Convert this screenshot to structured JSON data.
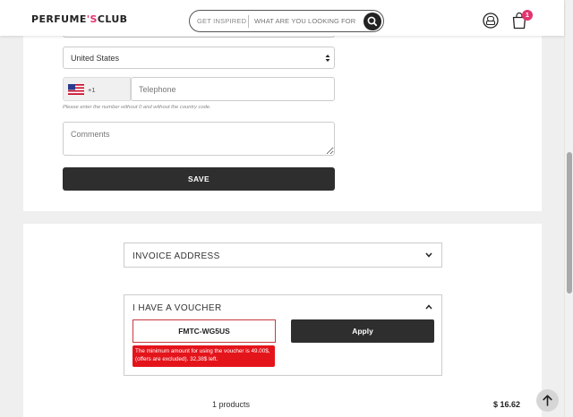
{
  "header": {
    "logo_main": "PERFUME",
    "logo_apos": "'S",
    "logo_end": "CLUB",
    "search_inspired": "GET INSPIRED",
    "search_placeholder": "WHAT ARE YOU LOOKING FOR",
    "cart_count": "1"
  },
  "form": {
    "country": "United States",
    "phone_code": "+1",
    "phone_placeholder": "Telephone",
    "phone_hint": "Please enter the number without 0 and without the country code.",
    "comments_placeholder": "Comments",
    "save_label": "SAVE"
  },
  "invoice": {
    "title": "INVOICE ADDRESS"
  },
  "voucher": {
    "title": "I HAVE A VOUCHER",
    "code": "FMTC-WG5US",
    "apply_label": "Apply",
    "error": "The minimum amount for using the voucher is 49.00$, (offers are excluded). 32,38$ left."
  },
  "summary": {
    "products": "1 products",
    "total": "$ 16.62"
  },
  "icons": {
    "search": "search-icon",
    "user": "user-icon",
    "cart": "cart-icon",
    "select_arrows": "select-arrows-icon",
    "flag": "us-flag-icon",
    "chevron_down": "chevron-down-icon",
    "chevron_up": "chevron-up-icon",
    "arrow_up": "arrow-up-icon"
  },
  "colors": {
    "brand": "#e2346f",
    "dark_button": "#2e2e2e",
    "error": "#e4141b"
  }
}
